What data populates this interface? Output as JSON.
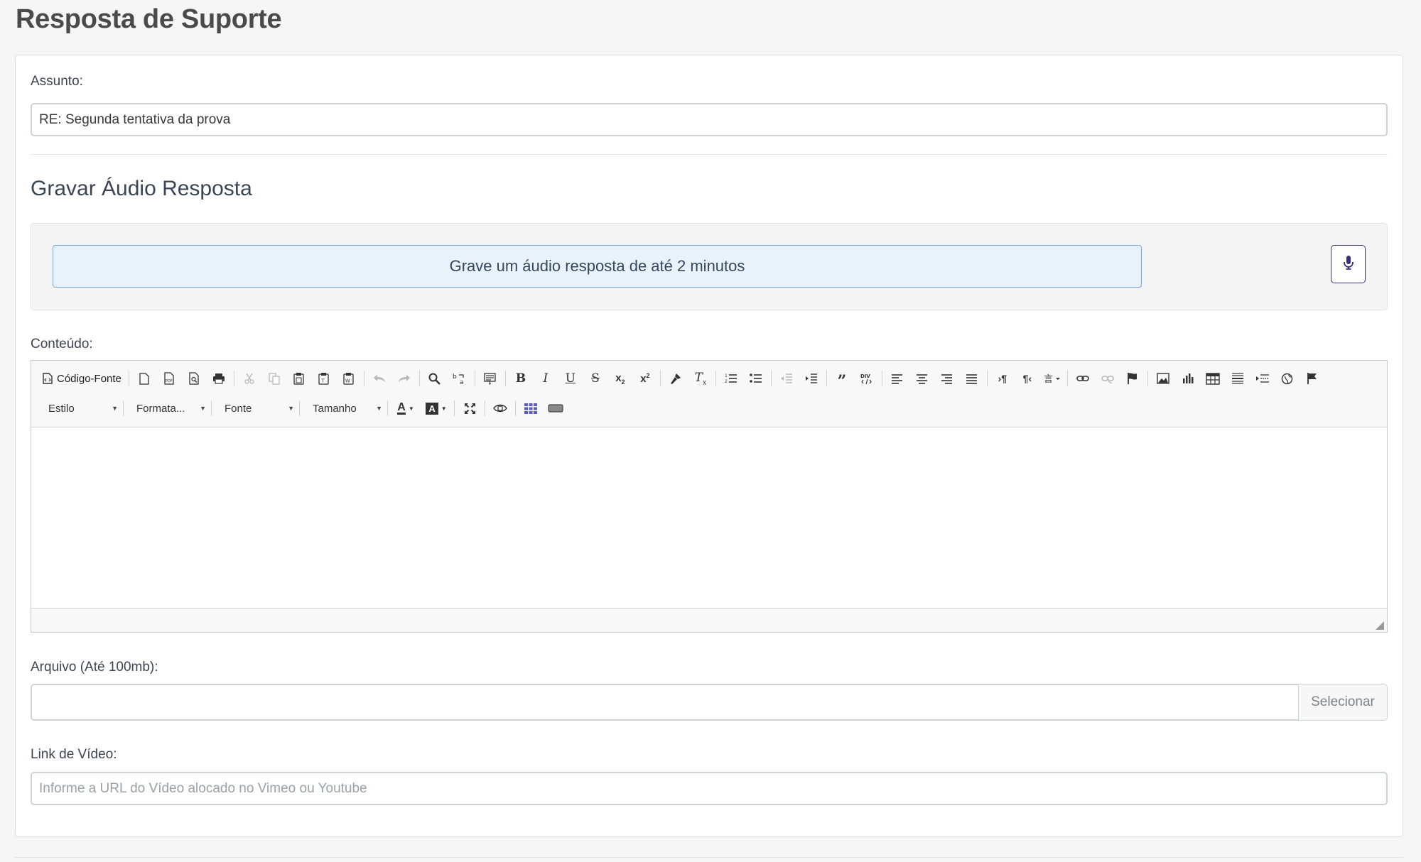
{
  "page": {
    "title": "Resposta de Suporte"
  },
  "form": {
    "subject_label": "Assunto:",
    "subject_value": "RE: Segunda tentativa da prova",
    "audio_title": "Gravar Áudio Resposta",
    "audio_message": "Grave um áudio resposta de até 2 minutos",
    "audio_record_icon": "microphone-icon",
    "content_label": "Conteúdo:",
    "file_label": "Arquivo (Até 100mb):",
    "file_value": "",
    "file_button": "Selecionar",
    "video_label": "Link de Vídeo:",
    "video_placeholder": "Informe a URL do Vídeo alocado no Vimeo ou Youtube"
  },
  "editor": {
    "source_label": "Código-Fonte",
    "style_combo": "Estilo",
    "format_combo": "Formata...",
    "font_combo": "Fonte",
    "size_combo": "Tamanho",
    "toolbar_icons": [
      "source-icon",
      "new-page-icon",
      "export-pdf-icon",
      "preview-icon",
      "print-icon",
      "cut-icon",
      "copy-icon",
      "paste-icon",
      "paste-text-icon",
      "paste-word-icon",
      "undo-icon",
      "redo-icon",
      "find-icon",
      "replace-icon",
      "select-all-icon",
      "bold-icon",
      "italic-icon",
      "underline-icon",
      "strike-icon",
      "subscript-icon",
      "superscript-icon",
      "copy-format-icon",
      "remove-format-icon",
      "numbered-list-icon",
      "bulleted-list-icon",
      "outdent-icon",
      "indent-icon",
      "blockquote-icon",
      "div-icon",
      "align-left-icon",
      "align-center-icon",
      "align-right-icon",
      "justify-icon",
      "ltr-icon",
      "rtl-icon",
      "language-icon",
      "link-icon",
      "unlink-icon",
      "anchor-icon",
      "image-icon",
      "chart-icon",
      "table-icon",
      "horizontal-rule-icon",
      "page-break-icon",
      "iframe-icon",
      "flag-icon",
      "text-color-icon",
      "background-color-icon",
      "maximize-icon",
      "show-blocks-icon",
      "grid-icon",
      "input-field-icon"
    ],
    "colors": {
      "toolbar_bg": "#f8f8f8",
      "border": "#c9c9c9"
    }
  },
  "colors": {
    "accent_blue": "#6ea8dd",
    "alert_bg": "#e9f2fb",
    "mic_border": "#3a2d7c"
  }
}
